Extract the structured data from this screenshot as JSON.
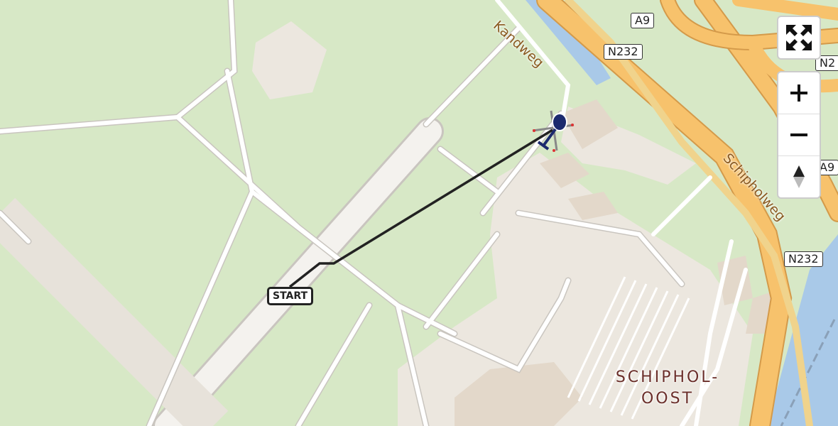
{
  "map": {
    "route_label": "START",
    "road_shields": [
      "A9",
      "N232",
      "N2",
      "A9",
      "N232"
    ],
    "streets": [
      "Kandweg",
      "Schipholweg"
    ],
    "district": [
      "SCHIPHOL-",
      "OOST"
    ],
    "colors": {
      "grass": "#d7e8c6",
      "apron": "#ece7df",
      "runway": "#f0eeea",
      "motorway": "#f7c26c",
      "water": "#a9c9e8",
      "track": "#222222",
      "heli": "#1c2a6e"
    }
  },
  "controls": {
    "fullscreen_icon": "fullscreen-icon",
    "zoom_in_icon": "plus-icon",
    "zoom_out_icon": "minus-icon",
    "compass_icon": "compass-icon"
  }
}
